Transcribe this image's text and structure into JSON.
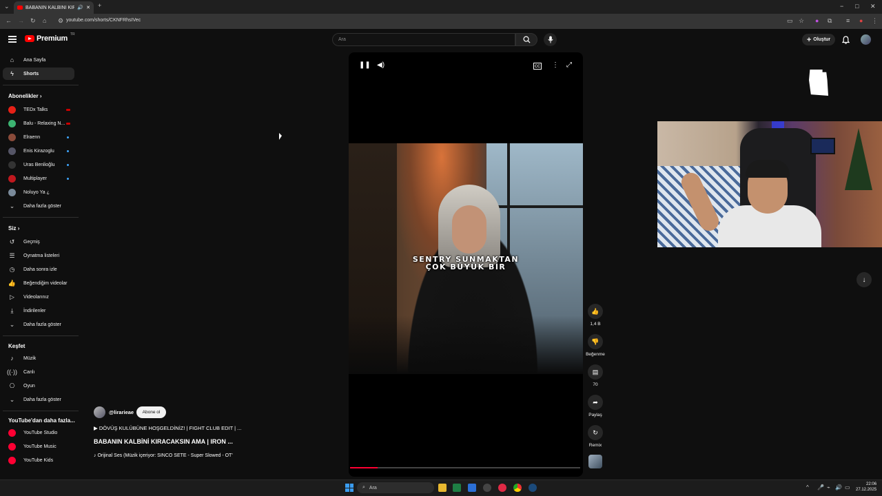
{
  "browser": {
    "tab_title": "BABANIN KALBİNİ KIRACA...",
    "url": "youtube.com/shorts/CKNFRhsIVec",
    "window_controls": [
      "−",
      "□",
      "✕"
    ]
  },
  "header": {
    "logo_text": "Premium",
    "logo_sup": "TR",
    "search_placeholder": "Ara",
    "create_label": "Oluştur"
  },
  "sidebar": {
    "main": [
      {
        "label": "Ana Sayfa",
        "icon": "home-icon"
      },
      {
        "label": "Shorts",
        "icon": "shorts-icon",
        "active": true
      }
    ],
    "subscriptions_title": "Abonelikler",
    "subscriptions": [
      {
        "label": "TEDx Talks",
        "color": "#e62117",
        "live": true
      },
      {
        "label": "Balu - Relaxing N...",
        "color": "#3cb371",
        "live": true
      },
      {
        "label": "Elraenn",
        "color": "#8a4b3a",
        "dot": true
      },
      {
        "label": "Enis Kirazoglu",
        "color": "#555566",
        "dot": true
      },
      {
        "label": "Uras Benlioğlu",
        "color": "#333333",
        "dot": true
      },
      {
        "label": "Multiplayer",
        "color": "#c0181e",
        "dot": true
      },
      {
        "label": "Noluyo Ya ¿",
        "color": "#7a8a9a"
      }
    ],
    "subs_more": "Daha fazla göster",
    "you_title": "Siz",
    "you": [
      {
        "label": "Geçmiş",
        "icon": "history-icon"
      },
      {
        "label": "Oynatma listeleri",
        "icon": "playlist-icon"
      },
      {
        "label": "Daha sonra izle",
        "icon": "clock-icon"
      },
      {
        "label": "Beğendiğim videolar",
        "icon": "like-icon"
      },
      {
        "label": "Videolarınız",
        "icon": "video-icon"
      },
      {
        "label": "İndirilenler",
        "icon": "download-icon"
      }
    ],
    "you_more": "Daha fazla göster",
    "explore_title": "Keşfet",
    "explore": [
      {
        "label": "Müzik",
        "icon": "music-icon"
      },
      {
        "label": "Canlı",
        "icon": "live-icon"
      },
      {
        "label": "Oyun",
        "icon": "gaming-icon"
      }
    ],
    "explore_more": "Daha fazla göster",
    "more_title": "YouTube'dan daha fazla...",
    "more": [
      {
        "label": "YouTube Studio"
      },
      {
        "label": "YouTube Music"
      },
      {
        "label": "YouTube Kids"
      }
    ]
  },
  "video": {
    "caption_line1": "SENTRY SUNMAKTAN",
    "caption_line2": "ÇOK BÜYÜK BİR",
    "progress": 0.12,
    "channel": "@lirarieae",
    "subscribe_label": "Abone ol",
    "playlist_line": "▶ DÖVÜŞ KULÜBÜNE HOŞGELDİNİZ! | FIGHT CLUB EDIT | ...",
    "title": "BABANIN KALBİNİ KIRACAKSIN AMA | IRON ...",
    "sound_line": "♪ Orijinal Ses (Müzik içeriyor: SINCO SETE - Super Slowed - OT'"
  },
  "actions": {
    "like_count": "1,4 B",
    "dislike_label": "Beğenme",
    "comment_count": "70",
    "share_label": "Paylaş",
    "remix_label": "Remix"
  },
  "taskbar": {
    "search_label": "Ara",
    "time": "22:06",
    "date": "27.12.2025"
  }
}
